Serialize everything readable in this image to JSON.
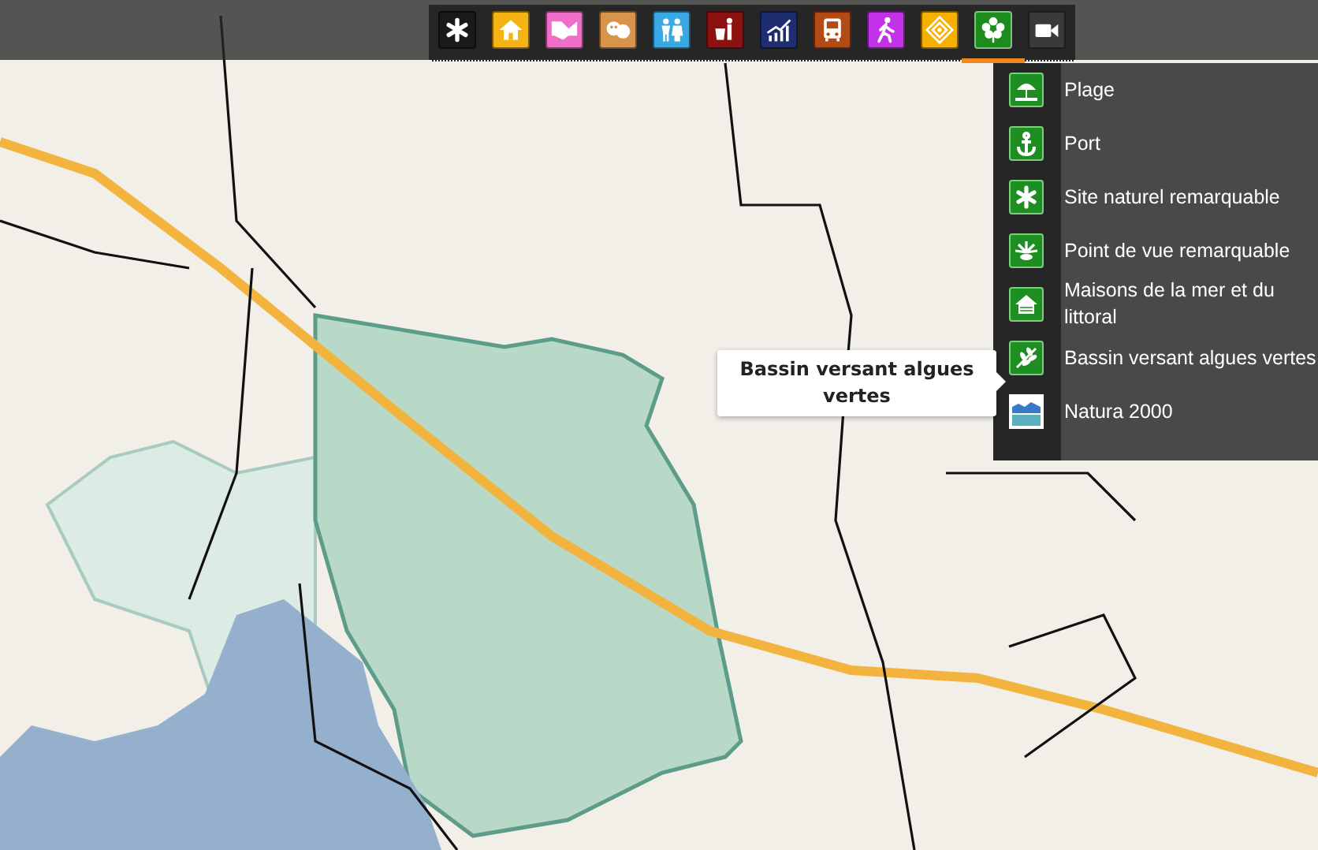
{
  "top_bar": {
    "toolbar": [
      {
        "color": "#1a1a1a",
        "selected": false
      },
      {
        "color": "#f5b414",
        "selected": false
      },
      {
        "color": "#f06ec8",
        "selected": false
      },
      {
        "color": "#d8944a",
        "selected": false
      },
      {
        "color": "#3aa8e2",
        "selected": false
      },
      {
        "color": "#8c1212",
        "selected": false
      },
      {
        "color": "#1e2c70",
        "selected": false
      },
      {
        "color": "#b44a14",
        "selected": false
      },
      {
        "color": "#c232e8",
        "selected": false
      },
      {
        "color": "#f8b000",
        "selected": false
      },
      {
        "color": "#1c8c1c",
        "selected": true
      },
      {
        "color": "#3a3a3a",
        "selected": false
      }
    ]
  },
  "category_menu": {
    "items": [
      {
        "label": "Plage",
        "kind": "green"
      },
      {
        "label": "Port",
        "kind": "green"
      },
      {
        "label": "Site naturel remarquable",
        "kind": "green"
      },
      {
        "label": "Point de vue remarquable",
        "kind": "green"
      },
      {
        "label": "Maisons de la mer et du littoral",
        "kind": "green"
      },
      {
        "label": "Bassin versant algues vertes",
        "kind": "green"
      },
      {
        "label": "Natura 2000",
        "kind": "logo"
      }
    ]
  },
  "tooltip": {
    "text": "Bassin versant algues vertes"
  }
}
